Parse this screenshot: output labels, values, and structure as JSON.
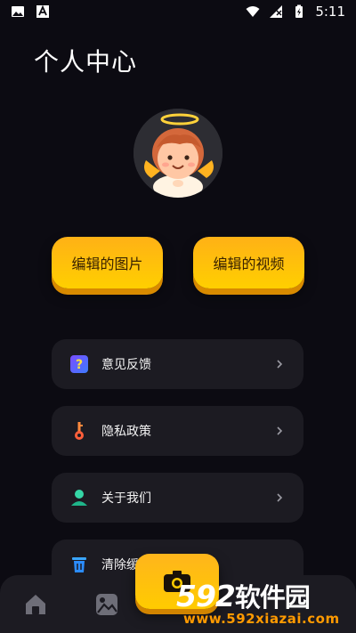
{
  "status_bar": {
    "time": "5:11",
    "left_icons": [
      "image-icon",
      "text-a-icon"
    ],
    "right_icons": [
      "wifi-icon",
      "signal-icon",
      "battery-charging-icon"
    ]
  },
  "page": {
    "title": "个人中心"
  },
  "actions": {
    "edited_images": "编辑的图片",
    "edited_videos": "编辑的视频"
  },
  "menu": {
    "items": [
      {
        "label": "意见反馈",
        "icon": "question-icon",
        "icon_color": "#5a6cff"
      },
      {
        "label": "隐私政策",
        "icon": "key-icon",
        "icon_color": "#ff7a3c"
      },
      {
        "label": "关于我们",
        "icon": "person-icon",
        "icon_color": "#2fd1a0"
      },
      {
        "label": "清除缓",
        "icon": "trash-icon",
        "icon_color": "#3aa6ff"
      }
    ]
  },
  "tab_bar": {
    "items": [
      "home-icon",
      "gallery-icon",
      "camera-icon"
    ]
  },
  "watermark": {
    "brand_number": "592",
    "brand_text": "软件园",
    "url": "www.592xiazai.com"
  },
  "colors": {
    "background": "#0c0b12",
    "card": "#1c1b22",
    "accent": "#ffc107"
  }
}
